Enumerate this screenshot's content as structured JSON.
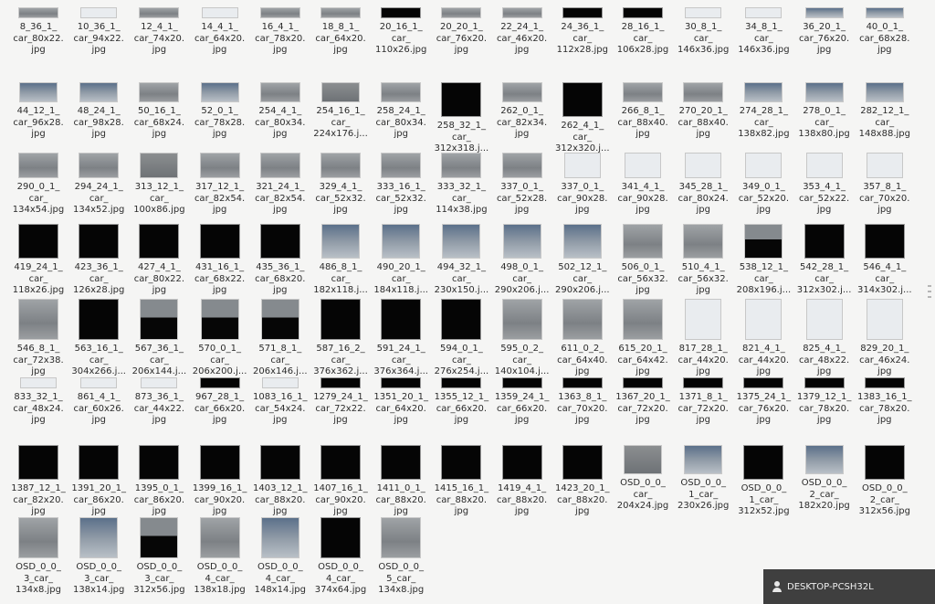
{
  "files": [
    {
      "name": "8_36_1_\ncar_80x22.\njpg",
      "thumb": "road"
    },
    {
      "name": "10_36_1_\ncar_94x22.\njpg",
      "thumb": "light"
    },
    {
      "name": "12_4_1_\ncar_74x20.\njpg",
      "thumb": "road"
    },
    {
      "name": "14_4_1_\ncar_64x20.\njpg",
      "thumb": "light"
    },
    {
      "name": "16_4_1_\ncar_78x20.\njpg",
      "thumb": "road"
    },
    {
      "name": "18_8_1_\ncar_64x20.\njpg",
      "thumb": "road"
    },
    {
      "name": "20_16_1_\ncar_\n110x26.jpg",
      "thumb": "dark"
    },
    {
      "name": "20_20_1_\ncar_76x20.\njpg",
      "thumb": "road"
    },
    {
      "name": "22_24_1_\ncar_46x20.\njpg",
      "thumb": "road"
    },
    {
      "name": "24_36_1_\ncar_\n112x28.jpg",
      "thumb": "dark"
    },
    {
      "name": "28_16_1_\ncar_\n106x28.jpg",
      "thumb": "dark"
    },
    {
      "name": "30_8_1_\ncar_\n146x36.jpg",
      "thumb": "light"
    },
    {
      "name": "34_8_1_\ncar_\n146x36.jpg",
      "thumb": "light"
    },
    {
      "name": "36_20_1_\ncar_76x20.\njpg",
      "thumb": "bluey"
    },
    {
      "name": "40_0_1_\ncar_68x28.\njpg",
      "thumb": "bluey"
    },
    {
      "name": "44_12_1_\ncar_96x28.\njpg",
      "thumb": "bluey"
    },
    {
      "name": "48_24_1_\ncar_98x28.\njpg",
      "thumb": "bluey"
    },
    {
      "name": "50_16_1_\ncar_68x24.\njpg",
      "thumb": "road"
    },
    {
      "name": "52_0_1_\ncar_78x28.\njpg",
      "thumb": "bluey"
    },
    {
      "name": "254_4_1_\ncar_80x34.\njpg",
      "thumb": "road"
    },
    {
      "name": "254_16_1_\ncar_\n224x176.j...",
      "thumb": "tall"
    },
    {
      "name": "258_24_1_\ncar_80x34.\njpg",
      "thumb": "road"
    },
    {
      "name": "258_32_1_\ncar_\n312x318.j...",
      "thumb": "dark"
    },
    {
      "name": "262_0_1_\ncar_82x34.\njpg",
      "thumb": "road"
    },
    {
      "name": "262_4_1_\ncar_\n312x320.j...",
      "thumb": "dark"
    },
    {
      "name": "266_8_1_\ncar_88x40.\njpg",
      "thumb": "road"
    },
    {
      "name": "270_20_1_\ncar_88x40.\njpg",
      "thumb": "road"
    },
    {
      "name": "274_28_1_\ncar_\n138x82.jpg",
      "thumb": "bluey"
    },
    {
      "name": "278_0_1_\ncar_\n138x80.jpg",
      "thumb": "bluey"
    },
    {
      "name": "282_12_1_\ncar_\n148x88.jpg",
      "thumb": "bluey"
    },
    {
      "name": "290_0_1_\ncar_\n134x54.jpg",
      "thumb": "road"
    },
    {
      "name": "294_24_1_\ncar_\n134x52.jpg",
      "thumb": "road"
    },
    {
      "name": "313_12_1_\ncar_\n100x86.jpg",
      "thumb": "tall"
    },
    {
      "name": "317_12_1_\ncar_82x54.\njpg",
      "thumb": "road"
    },
    {
      "name": "321_24_1_\ncar_82x54.\njpg",
      "thumb": "road"
    },
    {
      "name": "329_4_1_\ncar_52x32.\njpg",
      "thumb": "road"
    },
    {
      "name": "333_16_1_\ncar_52x32.\njpg",
      "thumb": "road"
    },
    {
      "name": "333_32_1_\ncar_\n114x38.jpg",
      "thumb": "road"
    },
    {
      "name": "337_0_1_\ncar_52x28.\njpg",
      "thumb": "road"
    },
    {
      "name": "337_0_1_\ncar_90x28.\njpg",
      "thumb": "light"
    },
    {
      "name": "341_4_1_\ncar_90x28.\njpg",
      "thumb": "light"
    },
    {
      "name": "345_28_1_\ncar_80x24.\njpg",
      "thumb": "light"
    },
    {
      "name": "349_0_1_\ncar_52x20.\njpg",
      "thumb": "light"
    },
    {
      "name": "353_4_1_\ncar_52x22.\njpg",
      "thumb": "light"
    },
    {
      "name": "357_8_1_\ncar_70x20.\njpg",
      "thumb": "light"
    },
    {
      "name": "419_24_1_\ncar_\n118x26.jpg",
      "thumb": "dark"
    },
    {
      "name": "423_36_1_\ncar_\n126x28.jpg",
      "thumb": "dark"
    },
    {
      "name": "427_4_1_\ncar_80x22.\njpg",
      "thumb": "dark"
    },
    {
      "name": "431_16_1_\ncar_68x22.\njpg",
      "thumb": "dark"
    },
    {
      "name": "435_36_1_\ncar_68x20.\njpg",
      "thumb": "dark"
    },
    {
      "name": "486_8_1_\ncar_\n182x118.j...",
      "thumb": "bluey"
    },
    {
      "name": "490_20_1_\ncar_\n184x118.j...",
      "thumb": "bluey"
    },
    {
      "name": "494_32_1_\ncar_\n230x150.j...",
      "thumb": "bluey"
    },
    {
      "name": "498_0_1_\ncar_\n290x206.j...",
      "thumb": "bluey"
    },
    {
      "name": "502_12_1_\ncar_\n290x206.j...",
      "thumb": "bluey"
    },
    {
      "name": "506_0_1_\ncar_56x32.\njpg",
      "thumb": "road"
    },
    {
      "name": "510_4_1_\ncar_56x32.\njpg",
      "thumb": "road"
    },
    {
      "name": "538_12_1_\ncar_\n208x196.j...",
      "thumb": "half"
    },
    {
      "name": "542_28_1_\ncar_\n312x302.j...",
      "thumb": "dark"
    },
    {
      "name": "546_4_1_\ncar_\n314x302.j...",
      "thumb": "dark"
    },
    {
      "name": "546_8_1_\ncar_72x38.\njpg",
      "thumb": "road"
    },
    {
      "name": "563_16_1_\ncar_\n304x266.j...",
      "thumb": "dark"
    },
    {
      "name": "567_36_1_\ncar_\n206x144.j...",
      "thumb": "half"
    },
    {
      "name": "570_0_1_\ncar_\n206x200.j...",
      "thumb": "half"
    },
    {
      "name": "571_8_1_\ncar_\n206x146.j...",
      "thumb": "half"
    },
    {
      "name": "587_16_2_\ncar_\n376x362.j...",
      "thumb": "dark"
    },
    {
      "name": "591_24_1_\ncar_\n376x364.j...",
      "thumb": "dark"
    },
    {
      "name": "594_0_1_\ncar_\n276x254.j...",
      "thumb": "dark"
    },
    {
      "name": "595_0_2_\ncar_\n140x104.j...",
      "thumb": "road"
    },
    {
      "name": "611_0_2_\ncar_64x40.\njpg",
      "thumb": "road"
    },
    {
      "name": "615_20_1_\ncar_64x42.\njpg",
      "thumb": "road"
    },
    {
      "name": "817_28_1_\ncar_44x20.\njpg",
      "thumb": "light"
    },
    {
      "name": "821_4_1_\ncar_44x20.\njpg",
      "thumb": "light"
    },
    {
      "name": "825_4_1_\ncar_48x22.\njpg",
      "thumb": "light"
    },
    {
      "name": "829_20_1_\ncar_46x24.\njpg",
      "thumb": "light"
    },
    {
      "name": "833_32_1_\ncar_48x24.\njpg",
      "thumb": "light"
    },
    {
      "name": "861_4_1_\ncar_60x26.\njpg",
      "thumb": "light"
    },
    {
      "name": "873_36_1_\ncar_44x22.\njpg",
      "thumb": "light"
    },
    {
      "name": "967_28_1_\ncar_66x20.\njpg",
      "thumb": "dark"
    },
    {
      "name": "1083_16_1_\ncar_54x24.\njpg",
      "thumb": "light"
    },
    {
      "name": "1279_24_1_\ncar_72x22.\njpg",
      "thumb": "dark"
    },
    {
      "name": "1351_20_1_\ncar_64x20.\njpg",
      "thumb": "dark"
    },
    {
      "name": "1355_12_1_\ncar_66x20.\njpg",
      "thumb": "dark"
    },
    {
      "name": "1359_24_1_\ncar_66x20.\njpg",
      "thumb": "dark"
    },
    {
      "name": "1363_8_1_\ncar_70x20.\njpg",
      "thumb": "dark"
    },
    {
      "name": "1367_20_1_\ncar_72x20.\njpg",
      "thumb": "dark"
    },
    {
      "name": "1371_8_1_\ncar_72x20.\njpg",
      "thumb": "dark"
    },
    {
      "name": "1375_24_1_\ncar_76x20.\njpg",
      "thumb": "dark"
    },
    {
      "name": "1379_12_1_\ncar_78x20.\njpg",
      "thumb": "dark"
    },
    {
      "name": "1383_16_1_\ncar_78x20.\njpg",
      "thumb": "dark"
    },
    {
      "name": "1387_12_1_\ncar_82x20.\njpg",
      "thumb": "dark"
    },
    {
      "name": "1391_20_1_\ncar_86x20.\njpg",
      "thumb": "dark"
    },
    {
      "name": "1395_0_1_\ncar_86x20.\njpg",
      "thumb": "dark"
    },
    {
      "name": "1399_16_1_\ncar_90x20.\njpg",
      "thumb": "dark"
    },
    {
      "name": "1403_12_1_\ncar_88x20.\njpg",
      "thumb": "dark"
    },
    {
      "name": "1407_16_1_\ncar_90x20.\njpg",
      "thumb": "dark"
    },
    {
      "name": "1411_0_1_\ncar_88x20.\njpg",
      "thumb": "dark"
    },
    {
      "name": "1415_16_1_\ncar_88x20.\njpg",
      "thumb": "dark"
    },
    {
      "name": "1419_4_1_\ncar_88x20.\njpg",
      "thumb": "dark"
    },
    {
      "name": "1423_20_1_\ncar_88x20.\njpg",
      "thumb": "dark"
    },
    {
      "name": "OSD_0_0_\ncar_\n204x24.jpg",
      "thumb": "tall"
    },
    {
      "name": "OSD_0_0_\n1_car_\n230x26.jpg",
      "thumb": "bluey"
    },
    {
      "name": "OSD_0_0_\n1_car_\n312x52.jpg",
      "thumb": "dark"
    },
    {
      "name": "OSD_0_0_\n2_car_\n182x20.jpg",
      "thumb": "bluey"
    },
    {
      "name": "OSD_0_0_\n2_car_\n312x56.jpg",
      "thumb": "dark"
    },
    {
      "name": "OSD_0_0_\n3_car_\n134x8.jpg",
      "thumb": "road"
    },
    {
      "name": "OSD_0_0_\n3_car_\n138x14.jpg",
      "thumb": "bluey"
    },
    {
      "name": "OSD_0_0_\n3_car_\n312x56.jpg",
      "thumb": "half"
    },
    {
      "name": "OSD_0_0_\n4_car_\n138x18.jpg",
      "thumb": "road"
    },
    {
      "name": "OSD_0_0_\n4_car_\n148x14.jpg",
      "thumb": "bluey"
    },
    {
      "name": "OSD_0_0_\n4_car_\n374x64.jpg",
      "thumb": "dark"
    },
    {
      "name": "OSD_0_0_\n5_car_\n134x8.jpg",
      "thumb": "road"
    }
  ],
  "status": {
    "user_label": "DESKTOP-PCSH32L"
  }
}
